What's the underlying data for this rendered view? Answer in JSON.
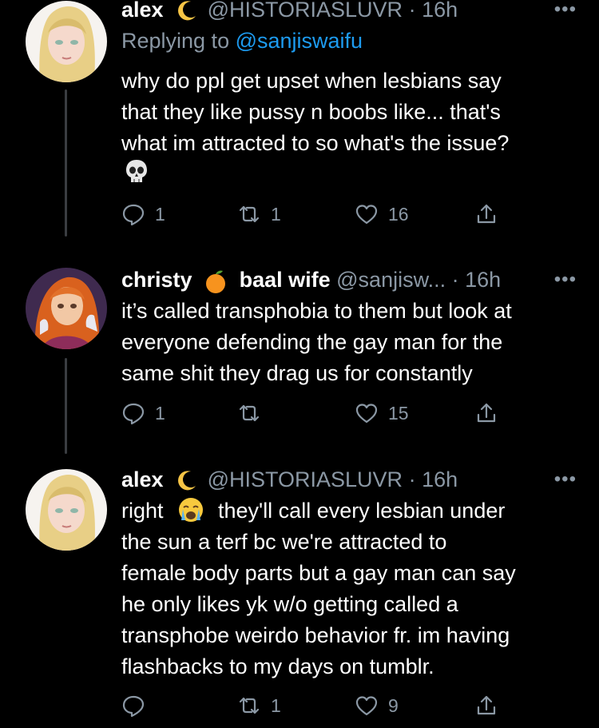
{
  "tweets": [
    {
      "name": "alex",
      "handle": "@HISTORIASLUVR",
      "time": "16h",
      "replying_prefix": "Replying to",
      "replying_to": "@sanjiswaifu",
      "text": "why do ppl get upset when lesbians say\nthat they like pussy n boobs like... that's\nwhat im attracted to so what's the issue?",
      "reply_count": "1",
      "retweet_count": "1",
      "like_count": "16"
    },
    {
      "name": "christy",
      "name_suffix": "baal wife",
      "handle": "@sanjisw...",
      "time": "16h",
      "text": "it’s called transphobia to them but look at\neveryone defending the gay man for the\nsame shit they drag us for constantly",
      "reply_count": "1",
      "retweet_count": "",
      "like_count": "15"
    },
    {
      "name": "alex",
      "handle": "@HISTORIASLUVR",
      "time": "16h",
      "text_start": "right",
      "text": "they'll call every lesbian under\nthe sun a terf bc we're attracted to\nfemale body parts but a gay man can say\nhe only likes yk w/o getting called a\ntransphobe weirdo behavior fr. im having\nflashbacks to my days on tumblr.",
      "reply_count": "",
      "retweet_count": "1",
      "like_count": "9"
    }
  ],
  "ui": {
    "dot": "·",
    "more": "•••"
  },
  "colors": {
    "background": "#000000",
    "text": "#ffffff",
    "muted": "#8b98a5",
    "link": "#1d9bf0"
  },
  "icons": {
    "avatars": [
      "alex-avatar-icon",
      "christy-avatar-icon",
      "alex-avatar-icon"
    ],
    "emojis": [
      "crescent-moon-icon",
      "skull-icon",
      "tangerine-icon",
      "crying-face-icon"
    ]
  }
}
